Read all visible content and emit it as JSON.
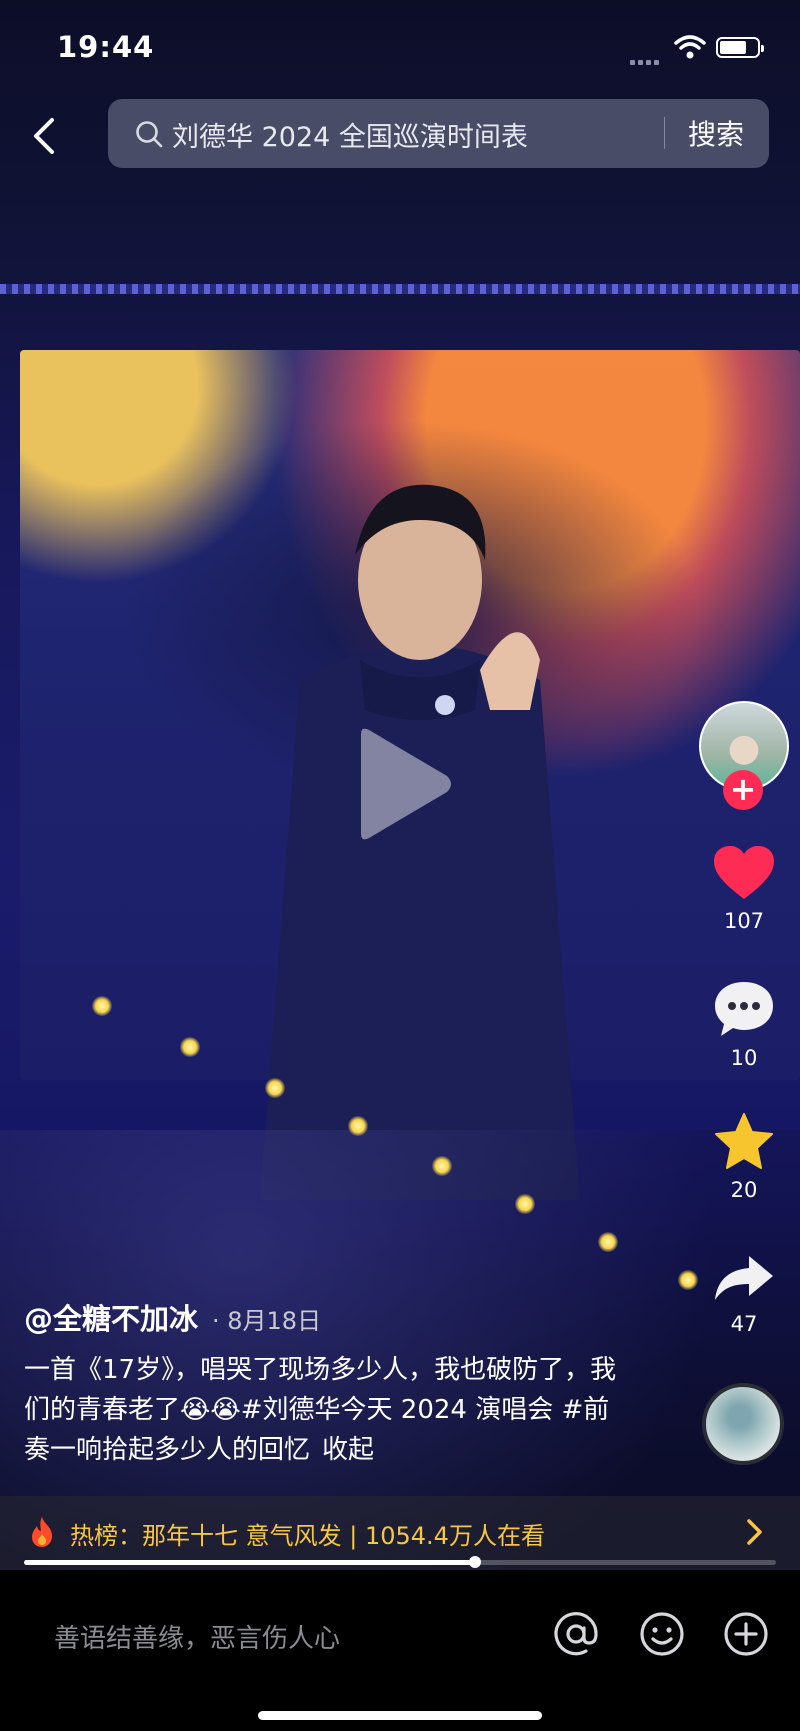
{
  "status_bar": {
    "time": "19:44"
  },
  "search": {
    "query": "刘德华 2024 全国巡演时间表",
    "button": "搜索"
  },
  "video": {
    "author": "@全糖不加冰",
    "date": "· 8月18日",
    "description": "一首《17岁》，唱哭了现场多少人，我也破防了，我们的青春老了😭😭#刘德华今天 2024 演唱会 #前奏一响拾起多少人的回忆",
    "collapse_label": "收起",
    "progress": 0.6
  },
  "actions": {
    "likes": "107",
    "comments": "10",
    "favorites": "20",
    "shares": "47"
  },
  "hot": {
    "text": "热榜：那年十七 意气风发 | 1054.4万人在看"
  },
  "comment_bar": {
    "placeholder": "善语结善缘，恶言伤人心"
  },
  "colors": {
    "accent": "#fe2c55",
    "hot_text": "#f6c644",
    "favorite": "#f7c62f"
  },
  "icons": [
    "back-arrow-icon",
    "search-icon",
    "play-icon",
    "follow-plus-icon",
    "heart-icon",
    "comment-icon",
    "star-icon",
    "share-icon",
    "fire-icon",
    "chevron-right-icon",
    "at-icon",
    "emoji-icon",
    "plus-circle-icon"
  ]
}
